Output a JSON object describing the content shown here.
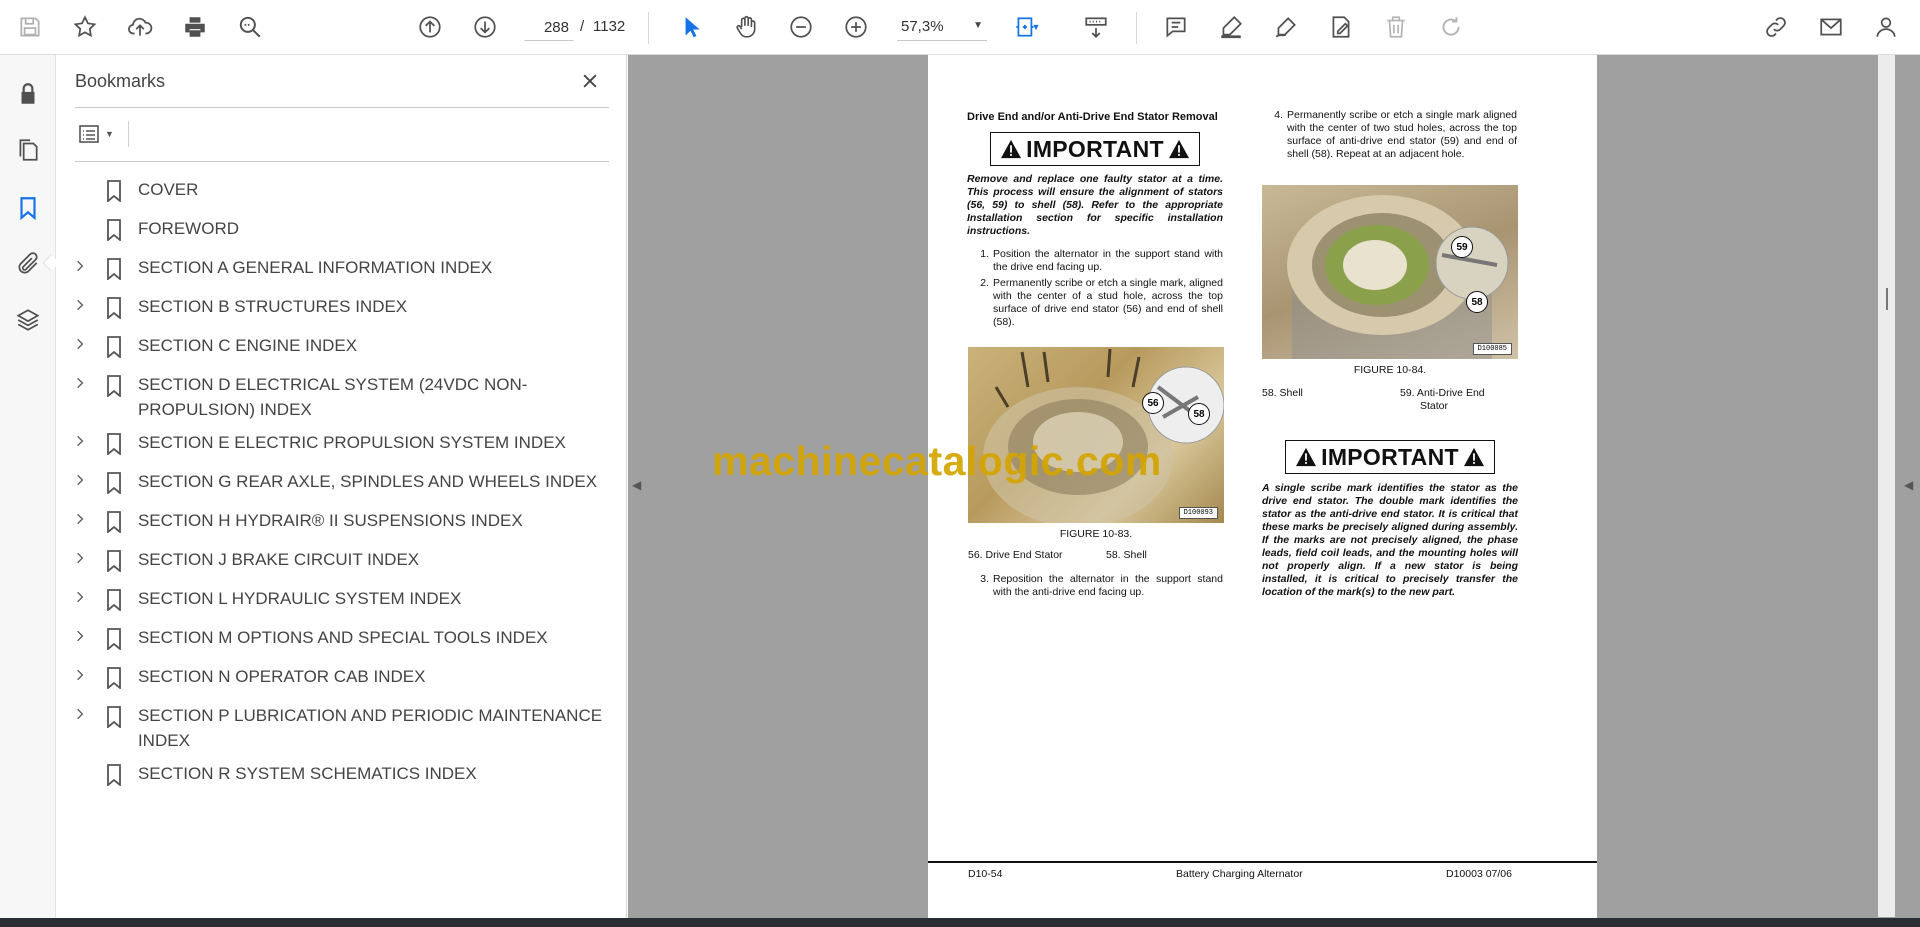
{
  "toolbar": {
    "page_current": "288",
    "page_separator": "/",
    "page_total": "1132",
    "zoom": "57,3%"
  },
  "bookmarks": {
    "title": "Bookmarks",
    "items": [
      {
        "label": "COVER",
        "expandable": false
      },
      {
        "label": "FOREWORD",
        "expandable": false
      },
      {
        "label": "SECTION A GENERAL INFORMATION INDEX",
        "expandable": true
      },
      {
        "label": "SECTION B STRUCTURES INDEX",
        "expandable": true
      },
      {
        "label": "SECTION C ENGINE INDEX",
        "expandable": true
      },
      {
        "label": "SECTION D ELECTRICAL SYSTEM (24VDC NON-PROPULSION) INDEX",
        "expandable": true
      },
      {
        "label": "SECTION E ELECTRIC PROPULSION SYSTEM INDEX",
        "expandable": true
      },
      {
        "label": "SECTION G REAR AXLE, SPINDLES AND WHEELS INDEX",
        "expandable": true
      },
      {
        "label": "SECTION H HYDRAIR® II SUSPENSIONS INDEX",
        "expandable": true
      },
      {
        "label": "SECTION J BRAKE CIRCUIT INDEX",
        "expandable": true
      },
      {
        "label": "SECTION L HYDRAULIC SYSTEM INDEX",
        "expandable": true
      },
      {
        "label": "SECTION M OPTIONS AND SPECIAL TOOLS INDEX",
        "expandable": true
      },
      {
        "label": "SECTION N OPERATOR CAB INDEX",
        "expandable": true
      },
      {
        "label": "SECTION P LUBRICATION AND PERIODIC MAINTENANCE INDEX",
        "expandable": true
      },
      {
        "label": "SECTION R SYSTEM SCHEMATICS INDEX",
        "expandable": false
      }
    ]
  },
  "document": {
    "left": {
      "heading": "Drive End and/or Anti-Drive End Stator Removal",
      "important_label": "IMPORTANT",
      "important_text": "Remove and replace one faulty stator at a time. This process will ensure the alignment of stators (56, 59) to shell (58). Refer to the appropriate Installation section for specific installation instructions.",
      "step1_num": "1.",
      "step1": "Position the alternator in the support stand with the drive end facing up.",
      "step2_num": "2.",
      "step2": "Permanently scribe or etch a single mark, aligned with the center of a stud hole, across the top surface of drive end stator (56) and end of shell (58).",
      "fig_callout_a": "56",
      "fig_callout_b": "58",
      "fig_id": "D100093",
      "fig_caption": "FIGURE 10-83.",
      "legend_a": "56. Drive End Stator",
      "legend_b": "58. Shell",
      "step3_num": "3.",
      "step3": "Reposition the alternator in the support stand with the anti-drive end facing up."
    },
    "right": {
      "step4_num": "4.",
      "step4": "Permanently scribe or etch a single mark aligned with the center of two stud holes, across the top surface of anti-drive end stator (59) and end of shell (58). Repeat at an adjacent hole.",
      "fig_callout_a": "59",
      "fig_callout_b": "58",
      "fig_id": "D100085",
      "fig_caption": "FIGURE 10-84.",
      "legend_a": "58. Shell",
      "legend_b1": "59. Anti-Drive End",
      "legend_b2": "Stator",
      "important_label": "IMPORTANT",
      "important_text": "A single scribe mark identifies the stator as the drive end stator. The double mark identifies the stator as the anti-drive end stator. It is critical that these marks be precisely aligned during assembly. If the marks are not precisely aligned, the phase leads, field coil leads, and the mounting holes will not properly align. If a new stator is being installed, it is critical to precisely transfer the location of the mark(s) to the new part."
    },
    "footer": {
      "left": "D10-54",
      "center": "Battery Charging Alternator",
      "right": "D10003 07/06"
    }
  },
  "watermark": "machinecatalogic.com",
  "colors": {
    "accent": "#1473e6",
    "viewer_bg": "#a0a0a0",
    "watermark": "#d4a500"
  },
  "icons": [
    "save-icon",
    "star-icon",
    "upload-icon",
    "print-icon",
    "zoom-search-icon",
    "page-up-icon",
    "page-down-icon",
    "select-cursor-icon",
    "hand-icon",
    "zoom-out-icon",
    "zoom-in-icon",
    "fit-page-icon",
    "scroll-mode-icon",
    "comment-icon",
    "highlight-icon",
    "draw-icon",
    "fill-sign-icon",
    "delete-icon",
    "redo-icon",
    "share-link-icon",
    "email-icon",
    "account-icon",
    "lock-icon",
    "pages-icon",
    "bookmark-icon",
    "attachment-icon",
    "layers-icon"
  ]
}
